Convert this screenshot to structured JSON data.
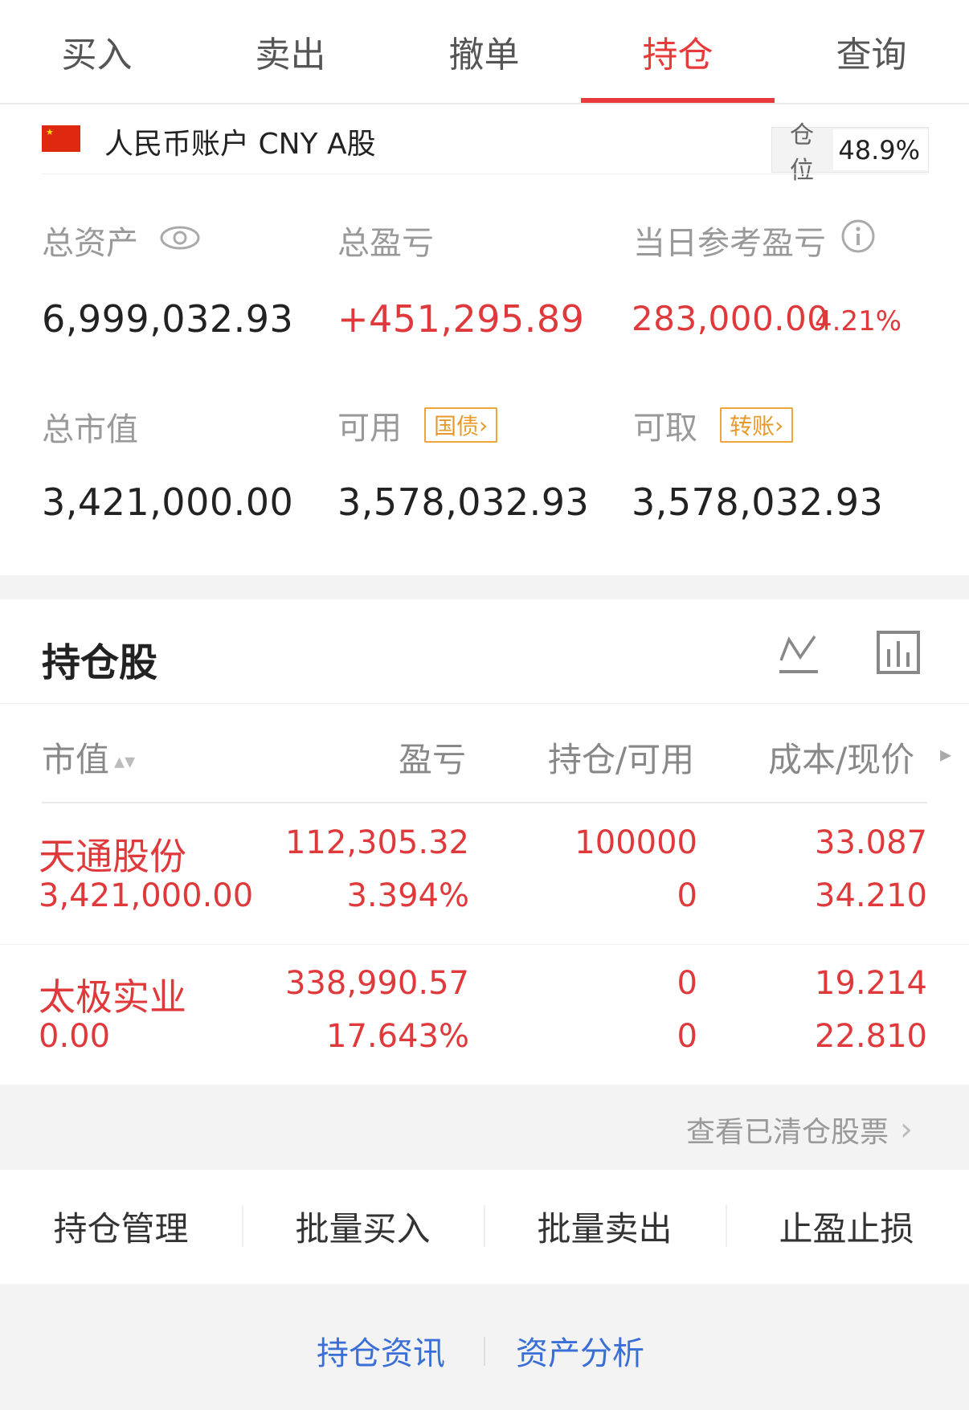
{
  "tabs": [
    "买入",
    "卖出",
    "撤单",
    "持仓",
    "查询"
  ],
  "active_tab": "持仓",
  "account": {
    "name": "人民币账户 CNY A股",
    "position_label": "仓位",
    "position_value": "48.9%"
  },
  "summary": {
    "total_assets_label": "总资产",
    "total_assets": "6,999,032.93",
    "total_pl_label": "总盈亏",
    "total_pl": "+451,295.89",
    "daily_pl_label": "当日参考盈亏",
    "daily_pl": "283,000.00",
    "daily_pl_pct": "4.21%",
    "market_value_label": "总市值",
    "market_value": "3,421,000.00",
    "available_label": "可用",
    "available_tag": "国债",
    "available": "3,578,032.93",
    "withdrawable_label": "可取",
    "withdrawable_tag": "转账",
    "withdrawable": "3,578,032.93"
  },
  "holdings": {
    "title": "持仓股",
    "columns": [
      "市值",
      "盈亏",
      "持仓/可用",
      "成本/现价"
    ],
    "rows": [
      {
        "name": "天通股份",
        "market_value": "3,421,000.00",
        "pl": "112,305.32",
        "pl_pct": "3.394%",
        "position": "100000",
        "available": "0",
        "cost": "33.087",
        "price": "34.210"
      },
      {
        "name": "太极实业",
        "market_value": "0.00",
        "pl": "338,990.57",
        "pl_pct": "17.643%",
        "position": "0",
        "available": "0",
        "cost": "19.214",
        "price": "22.810"
      }
    ],
    "cleared_link": "查看已清仓股票"
  },
  "actions": [
    "持仓管理",
    "批量买入",
    "批量卖出",
    "止盈止损"
  ],
  "bottom_links": [
    "持仓资讯",
    "资产分析"
  ],
  "colors": {
    "accent": "#e83a3a",
    "gain": "#e0393c",
    "tag": "#f0a53a",
    "link": "#3a6fd8"
  }
}
